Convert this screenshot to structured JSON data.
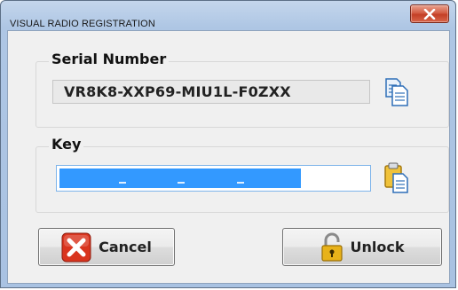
{
  "window": {
    "title": "VISUAL RADIO REGISTRATION"
  },
  "serial": {
    "group_label": "Serial Number",
    "value": "VR8K8-XXP69-MIU1L-F0ZXX"
  },
  "key": {
    "group_label": "Key",
    "value": ""
  },
  "buttons": {
    "cancel_label": "Cancel",
    "unlock_label": "Unlock"
  },
  "colors": {
    "selection": "#3399ff",
    "close": "#c43f26",
    "cancel_icon": "#d9341e",
    "lock": "#e8b21a"
  }
}
